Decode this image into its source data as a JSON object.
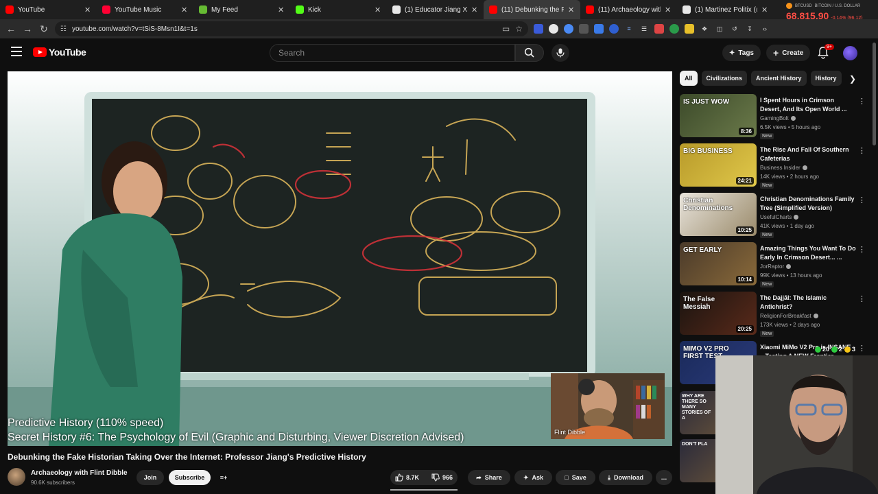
{
  "browser": {
    "tabs": [
      {
        "label": "YouTube",
        "favicon_color": "#ff0000"
      },
      {
        "label": "YouTube Music",
        "favicon_color": "#ff0033"
      },
      {
        "label": "My Feed",
        "favicon_color": "#66bb33"
      },
      {
        "label": "Kick",
        "favicon_color": "#53fc18"
      },
      {
        "label": "(1) Educator Jiang Xueqin",
        "favicon_color": "#e8e8e8"
      },
      {
        "label": "(11) Debunking the Fa",
        "favicon_color": "#ff0000"
      },
      {
        "label": "(11) Archaeology with Flin",
        "favicon_color": "#ff0000"
      },
      {
        "label": "(1) Martinez Politix (@mar",
        "favicon_color": "#e8e8e8"
      }
    ],
    "active_tab_index": 5,
    "url": "youtube.com/watch?v=tSiS-8Msn1I&t=1s",
    "ticker": {
      "symbol": "BTCUSD",
      "name": "BITCOIN / U.S. DOLLAR",
      "price": "68,815.90",
      "change": "-0.14% (96.12)"
    }
  },
  "header": {
    "logo_text": "YouTube",
    "search_placeholder": "Search",
    "tags_label": "Tags",
    "create_label": "Create",
    "notification_count": "9+"
  },
  "player": {
    "caption_line1": "Predictive History (110% speed)",
    "caption_line2": "Secret History #6: The Psychology of Evil (Graphic and Disturbing, Viewer Discretion Advised)",
    "inset_name": "Flint Dibble",
    "board_words": [
      "RA",
      "Apophis",
      "Isis",
      "controller",
      "Set",
      "Osiris",
      "trauma",
      "Horus",
      "RAPE",
      "monkey island",
      "ritual",
      "psychedelics",
      "programming",
      "noumena"
    ]
  },
  "video": {
    "title": "Debunking the Fake Historian Taking Over the Internet: Professor Jiang's Predictive History",
    "channel": "Archaeology with Flint Dibble",
    "subscribers": "90.6K subscribers",
    "join_label": "Join",
    "subscribe_label": "Subscribe",
    "likes": "8.7K",
    "dislikes": "966",
    "share_label": "Share",
    "ask_label": "Ask",
    "save_label": "Save",
    "download_label": "Download"
  },
  "sidebar": {
    "chips": [
      "All",
      "Civilizations",
      "Ancient History",
      "History"
    ],
    "recommendations": [
      {
        "title": "I Spent Hours in Crimson Desert, And Its Open World ...",
        "channel": "GamingBolt",
        "verified": true,
        "meta": "6.5K views • 5 hours ago",
        "badge": "New",
        "duration": "8:36",
        "thumb_text": "IS JUST WOW",
        "thumb_colors": [
          "#3c4a2a",
          "#6b7a4a"
        ]
      },
      {
        "title": "The Rise And Fall Of Southern Cafeterias",
        "channel": "Business Insider",
        "verified": true,
        "meta": "14K views • 2 hours ago",
        "badge": "New",
        "duration": "24:21",
        "thumb_text": "BIG BUSINESS",
        "thumb_colors": [
          "#b89a2a",
          "#e0c84a"
        ]
      },
      {
        "title": "Christian Denominations Family Tree (Simplified Version)",
        "channel": "UsefulCharts",
        "verified": true,
        "meta": "41K views • 1 day ago",
        "badge": "New",
        "duration": "10:25",
        "thumb_text": "Christian Denominations",
        "thumb_colors": [
          "#e8e4dc",
          "#9a8a6a"
        ]
      },
      {
        "title": "Amazing Things You Want To Do Early In Crimson Desert... ...",
        "channel": "JorRaptor",
        "verified": true,
        "meta": "99K views • 13 hours ago",
        "badge": "New",
        "duration": "10:14",
        "thumb_text": "GET EARLY",
        "thumb_colors": [
          "#4a3a2a",
          "#8a6a3a"
        ]
      },
      {
        "title": "The Dajjāl: The Islamic Antichrist?",
        "channel": "ReligionForBreakfast",
        "verified": true,
        "meta": "173K views • 2 days ago",
        "badge": "New",
        "duration": "20:25",
        "thumb_text": "The False Messiah",
        "thumb_colors": [
          "#1a1410",
          "#5a2a1a"
        ]
      },
      {
        "title": "Xiaomi MiMo V2 Pro is INSANE – Testing A NEW Frontier...",
        "channel": "",
        "verified": false,
        "meta": "",
        "badge": "",
        "duration": "",
        "thumb_text": "MIMO V2 PRO FIRST TEST",
        "thumb_colors": [
          "#1a2a5a",
          "#2a3a7a"
        ]
      }
    ],
    "extra_thumbs": [
      "WHY ARE THERE SO MANY STORIES OF A",
      "DON'T PLA"
    ],
    "overlay_counts": [
      "20",
      "2",
      "3"
    ]
  }
}
